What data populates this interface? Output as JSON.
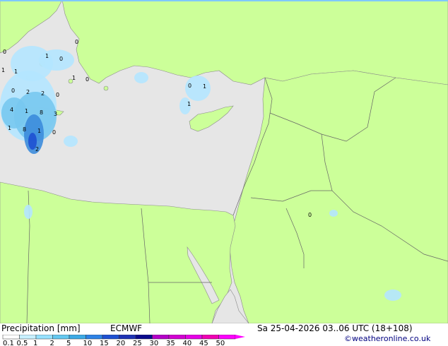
{
  "title": "Precipitation [mm]",
  "model": "ECMWF",
  "datetime": "Sa 25-04-2026 03..06 UTC (18+108)",
  "credit": "©weatheronline.co.uk",
  "legend": {
    "ticks": [
      "0.1",
      "0.5",
      "1",
      "2",
      "5",
      "10",
      "15",
      "20",
      "25",
      "30",
      "35",
      "40",
      "45",
      "50"
    ],
    "colors": [
      "#ffffff",
      "#c8f0ff",
      "#96e1ff",
      "#64c8f0",
      "#3caae6",
      "#2d82e6",
      "#1e50d2",
      "#1e32b4",
      "#0a0a8c",
      "#b400c8",
      "#d200d2",
      "#e600e6",
      "#f000b4",
      "#ff00ff"
    ]
  },
  "colors": {
    "land": "#ccff99",
    "sea": "#e6e6e6",
    "border": "#666666",
    "precip_light": "#b4e6ff",
    "precip_mid": "#78c8f0",
    "precip_heavy": "#3c8cdc"
  },
  "map_labels": [
    {
      "text": "0",
      "pos": "aegean-west"
    },
    {
      "text": "1",
      "pos": "aegean-north"
    },
    {
      "text": "0",
      "pos": "aegean-north-east"
    },
    {
      "text": "0",
      "pos": "aegean-islands"
    },
    {
      "text": "1",
      "pos": "aegean-west-2"
    },
    {
      "text": "1",
      "pos": "aegean-west-3"
    },
    {
      "text": "0",
      "pos": "dodecanese"
    },
    {
      "text": "1",
      "pos": "dodecanese-2"
    },
    {
      "text": "0",
      "pos": "crete-north"
    },
    {
      "text": "2",
      "pos": "crete-north-2"
    },
    {
      "text": "2",
      "pos": "crete-north-3"
    },
    {
      "text": "0",
      "pos": "crete-north-4"
    },
    {
      "text": "4",
      "pos": "crete-west"
    },
    {
      "text": "1",
      "pos": "crete-west-2"
    },
    {
      "text": "8",
      "pos": "crete-center"
    },
    {
      "text": "3",
      "pos": "crete-east"
    },
    {
      "text": "1",
      "pos": "south-crete"
    },
    {
      "text": "8",
      "pos": "south-crete-2"
    },
    {
      "text": "1",
      "pos": "south-crete-3"
    },
    {
      "text": "0",
      "pos": "south-crete-4"
    },
    {
      "text": "2",
      "pos": "libyan-sea"
    },
    {
      "text": "0",
      "pos": "turkey-south"
    },
    {
      "text": "1",
      "pos": "turkey-south-2"
    },
    {
      "text": "1",
      "pos": "cyprus-west"
    },
    {
      "text": "0",
      "pos": "saudi"
    }
  ]
}
